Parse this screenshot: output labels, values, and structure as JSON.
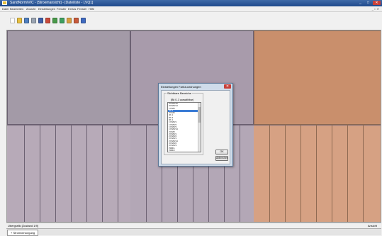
{
  "window": {
    "title": "SandNorm/VIC - [Stroemansicht] - [Dateiliste - LVQ1]",
    "controls": [
      "_",
      "□",
      "✕"
    ]
  },
  "menu": {
    "items": [
      "Datei",
      "Bearbeiten",
      "Ansicht",
      "Einstellungen",
      "Fenster",
      "Extras",
      "Fenster",
      "Hilfe"
    ]
  },
  "toolbar": {
    "icons": [
      {
        "name": "new-document-icon",
        "color": "#ffffff"
      },
      {
        "name": "open-folder-icon",
        "color": "#e8c040"
      },
      {
        "name": "import-icon",
        "color": "#4f7fbf"
      },
      {
        "name": "print-icon",
        "color": "#9aa4b2"
      },
      {
        "name": "save-icon",
        "color": "#3f5fa8"
      },
      {
        "name": "chart-icon",
        "color": "#c94a3a"
      },
      {
        "name": "people-icon",
        "color": "#4a9a4a"
      },
      {
        "name": "tree-icon",
        "color": "#3f9f5f"
      },
      {
        "name": "settings-icon",
        "color": "#d8a040"
      },
      {
        "name": "export-icon",
        "color": "#c85a3a"
      },
      {
        "name": "help-icon",
        "color": "#3f6ac0"
      }
    ]
  },
  "dialog": {
    "title": "Einstellungen Farbzuordnungen",
    "group_label": "Sichtbare Bereiche",
    "hint": "(Bit 0..3 auswählbar)",
    "items": [
      "0YWR/15",
      "0YWR/14",
      "1YWR",
      "2K.3",
      "3YWR",
      "4K.1",
      "5K.3",
      "6K.1",
      "1YWR/1",
      "1YWR/2",
      "1YWR/3",
      "1YWR/14",
      "2YWR",
      "2YWR/1",
      "2YWR/2",
      "3YWR/1",
      "2YWR/14",
      "3YWR/2",
      "3YWR/3",
      "PRB/1",
      "PRB/2",
      "PRB/3",
      "PRB/7",
      "PRB/14"
    ],
    "selected_index": 3,
    "ok_label": "OK",
    "cancel_label": "Abbrechen"
  },
  "status": {
    "left": "Ubergrafik [Zustand 1/9]",
    "right": "Ansicht"
  },
  "tabs": [
    {
      "label": "Stromversorgung"
    }
  ],
  "colors": {
    "panel_left": "#a39aa7",
    "panel_mid": "#a89bab",
    "panel_right": "#c98f6c"
  }
}
